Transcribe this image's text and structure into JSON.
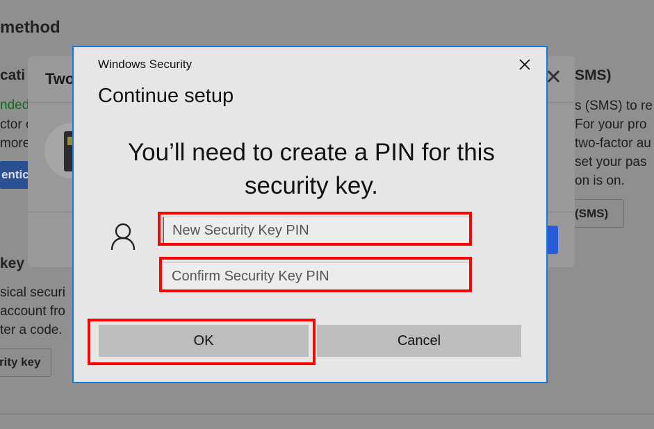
{
  "background_page": {
    "heading": "method",
    "left_column": {
      "section_heading": "cati",
      "recommended": "nded",
      "lines": [
        "ctor o",
        "more"
      ],
      "button": "entica",
      "key_heading": "key",
      "key_lines": [
        "sical securi",
        "account fro",
        "ter a code."
      ],
      "key_button": "rity key"
    },
    "right_column": {
      "heading": "SMS)",
      "lines": [
        "s (SMS) to re",
        "For your pro",
        "two-factor au",
        "set your pas",
        "on is on."
      ],
      "button": "(SMS)"
    },
    "middle_dialog": {
      "title": "Two",
      "close_glyph": "✕"
    }
  },
  "dialog": {
    "app_name": "Windows Security",
    "close_glyph": "✕",
    "title": "Continue setup",
    "message": "You’ll need to create a PIN for this security key.",
    "pin_field": {
      "placeholder": "New Security Key PIN",
      "value": ""
    },
    "confirm_field": {
      "placeholder": "Confirm Security Key PIN",
      "value": ""
    },
    "ok_label": "OK",
    "cancel_label": "Cancel",
    "user_icon": "user-icon"
  },
  "colors": {
    "accent_border": "#1b78d6",
    "highlight": "#ff0000",
    "dialog_bg": "#e6e6e6",
    "button_bg": "#bdbdbd"
  }
}
